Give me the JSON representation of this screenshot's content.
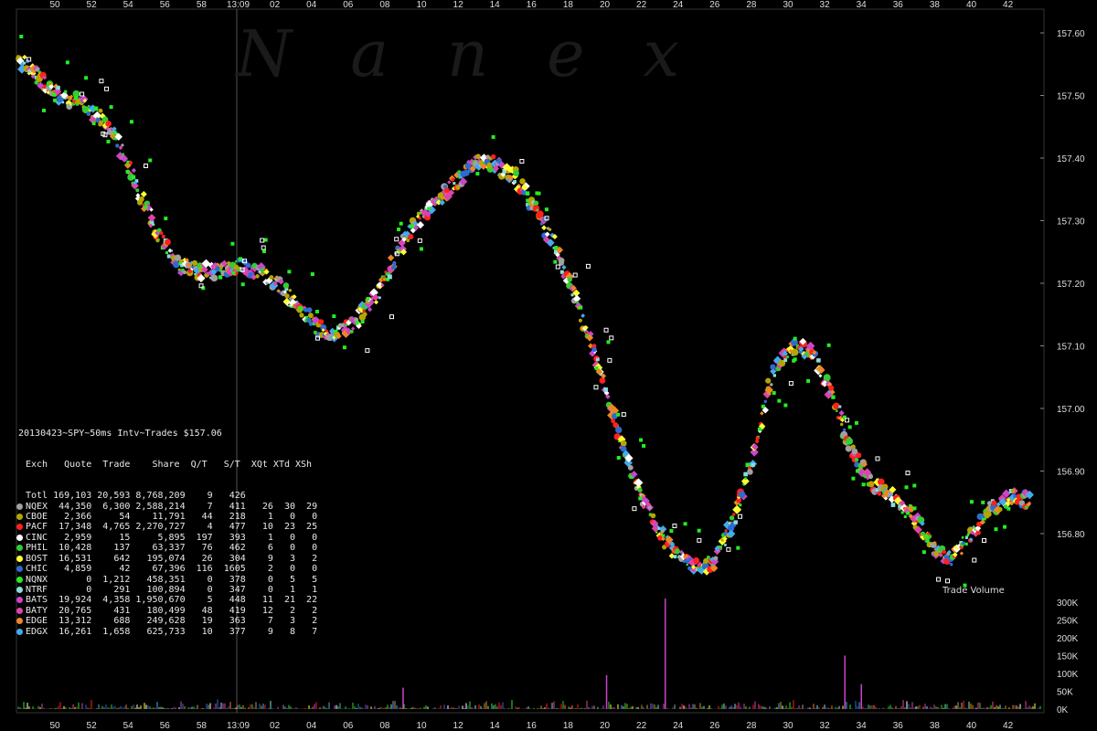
{
  "watermark": "Nanex",
  "chart_data": [
    {
      "type": "scatter",
      "title": "20130423~SPY~50ms Intv~Trades $157.06",
      "x_ticks": [
        "50",
        "52",
        "54",
        "56",
        "58",
        "13:09",
        "02",
        "04",
        "06",
        "08",
        "10",
        "12",
        "14",
        "16",
        "18",
        "20",
        "22",
        "24",
        "26",
        "28",
        "30",
        "32",
        "34",
        "36",
        "38",
        "40",
        "42"
      ],
      "y_ticks": [
        "157.60",
        "157.50",
        "157.40",
        "157.30",
        "157.20",
        "157.10",
        "157.00",
        "156.90",
        "156.80"
      ],
      "ylim": [
        156.74,
        157.63
      ],
      "series": [
        {
          "name": "NQEX",
          "color": "#a0a0a0",
          "marker": "circle"
        },
        {
          "name": "CBOE",
          "color": "#b5a500",
          "marker": "circle"
        },
        {
          "name": "PACF",
          "color": "#ff2020",
          "marker": "circle"
        },
        {
          "name": "CINC",
          "color": "#ffffff",
          "marker": "diamond"
        },
        {
          "name": "PHIL",
          "color": "#33cc33",
          "marker": "circle"
        },
        {
          "name": "BOST",
          "color": "#ffff33",
          "marker": "diamond"
        },
        {
          "name": "CHIC",
          "color": "#2f6ad0",
          "marker": "circle"
        },
        {
          "name": "NQNX",
          "color": "#22ee22",
          "marker": "square"
        },
        {
          "name": "NTRF",
          "color": "#88dddd",
          "marker": "square"
        },
        {
          "name": "BATS",
          "color": "#cc44cc",
          "marker": "diamond"
        },
        {
          "name": "BATY",
          "color": "#dd44aa",
          "marker": "diamond"
        },
        {
          "name": "EDGE",
          "color": "#ee8822",
          "marker": "diamond"
        },
        {
          "name": "EDGX",
          "color": "#44aaee",
          "marker": "diamond"
        }
      ],
      "price_path": [
        [
          0,
          157.56
        ],
        [
          1,
          157.53
        ],
        [
          2,
          157.5
        ],
        [
          3,
          157.49
        ],
        [
          4,
          157.47
        ],
        [
          5,
          157.43
        ],
        [
          6,
          157.35
        ],
        [
          7,
          157.28
        ],
        [
          8,
          157.23
        ],
        [
          9,
          157.22
        ],
        [
          10,
          157.22
        ],
        [
          11,
          157.23
        ],
        [
          12,
          157.22
        ],
        [
          13,
          157.2
        ],
        [
          14,
          157.17
        ],
        [
          15,
          157.13
        ],
        [
          16,
          157.12
        ],
        [
          17,
          157.14
        ],
        [
          18,
          157.18
        ],
        [
          19,
          157.24
        ],
        [
          20,
          157.3
        ],
        [
          21,
          157.33
        ],
        [
          22,
          157.36
        ],
        [
          23,
          157.39
        ],
        [
          24,
          157.39
        ],
        [
          25,
          157.37
        ],
        [
          26,
          157.32
        ],
        [
          27,
          157.26
        ],
        [
          28,
          157.18
        ],
        [
          29,
          157.09
        ],
        [
          30,
          156.98
        ],
        [
          31,
          156.89
        ],
        [
          32,
          156.82
        ],
        [
          33,
          156.77
        ],
        [
          34,
          156.75
        ],
        [
          35,
          156.75
        ],
        [
          36,
          156.82
        ],
        [
          37,
          156.92
        ],
        [
          38,
          157.06
        ],
        [
          39,
          157.1
        ],
        [
          40,
          157.09
        ],
        [
          41,
          157.02
        ],
        [
          42,
          156.93
        ],
        [
          43,
          156.88
        ],
        [
          44,
          156.86
        ],
        [
          45,
          156.83
        ],
        [
          46,
          156.78
        ],
        [
          47,
          156.76
        ],
        [
          48,
          156.8
        ],
        [
          49,
          156.84
        ],
        [
          50,
          156.86
        ],
        [
          51,
          156.85
        ]
      ]
    },
    {
      "type": "bar",
      "title": "Trade Volume",
      "y_ticks": [
        "300K",
        "250K",
        "200K",
        "150K",
        "100K",
        "50K",
        "0K"
      ],
      "ylim": [
        0,
        300000
      ],
      "spikes": [
        {
          "minute": 23.3,
          "value": 310000
        },
        {
          "minute": 33.1,
          "value": 150000
        },
        {
          "minute": 20.1,
          "value": 95000
        },
        {
          "minute": 34.0,
          "value": 70000
        },
        {
          "minute": 9.0,
          "value": 60000
        }
      ]
    }
  ],
  "stats": {
    "title": "20130423~SPY~50ms Intv~Trades $157.06",
    "header": "Exch   Quote  Trade    Share  Q/T   S/T  XQt XTd XSh",
    "rows": [
      {
        "text": "Totl 169,103 20,593 8,768,209    9   426",
        "color": ""
      },
      {
        "text": "NQEX  44,350  6,300 2,588,214    7   411   26  30  29",
        "color": "#a0a0a0"
      },
      {
        "text": "CBOE   2,366     54    11,791   44   218    1   0   0",
        "color": "#b5a500"
      },
      {
        "text": "PACF  17,348  4,765 2,270,727    4   477   10  23  25",
        "color": "#ff2020"
      },
      {
        "text": "CINC   2,959     15     5,895  197   393    1   0   0",
        "color": "#ffffff"
      },
      {
        "text": "PHIL  10,428    137    63,337   76   462    6   0   0",
        "color": "#33cc33"
      },
      {
        "text": "BOST  16,531    642   195,074   26   304    9   3   2",
        "color": "#ffff33"
      },
      {
        "text": "CHIC   4,859     42    67,396  116  1605    2   0   0",
        "color": "#2f6ad0"
      },
      {
        "text": "NQNX       0  1,212   458,351    0   378    0   5   5",
        "color": "#22ee22"
      },
      {
        "text": "NTRF       0    291   100,894    0   347    0   1   1",
        "color": "#88dddd"
      },
      {
        "text": "BATS  19,924  4,358 1,950,670    5   448   11  21  22",
        "color": "#cc44cc"
      },
      {
        "text": "BATY  20,765    431   180,499   48   419   12   2   2",
        "color": "#dd44aa"
      },
      {
        "text": "EDGE  13,312    688   249,628   19   363    7   3   2",
        "color": "#ee8822"
      },
      {
        "text": "EDGX  16,261  1,658   625,733   10   377    9   8   7",
        "color": "#44aaee"
      }
    ]
  },
  "volume_label": "Trade Volume"
}
